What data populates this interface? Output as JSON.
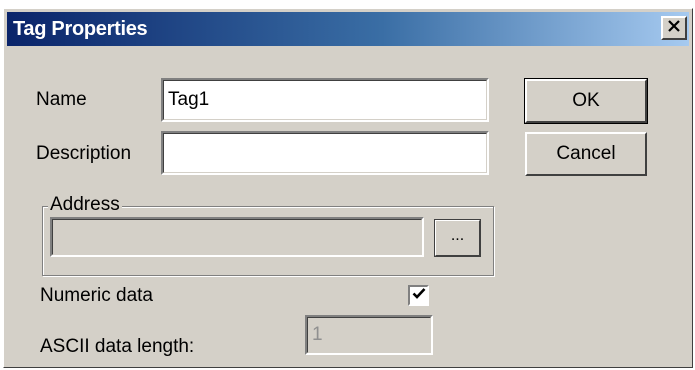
{
  "window": {
    "title": "Tag Properties",
    "close_label": "×"
  },
  "form": {
    "name_label": "Name",
    "name_value": "Tag1",
    "description_label": "Description",
    "description_value": "",
    "address_group_label": "Address",
    "address_value": "",
    "browse_button_label": "...",
    "numeric_label": "Numeric data",
    "numeric_checked": true,
    "ascii_label": "ASCII data length:",
    "ascii_value": "1"
  },
  "buttons": {
    "ok_label": "OK",
    "cancel_label": "Cancel"
  },
  "colors": {
    "title_gradient_start": "#0a246a",
    "title_gradient_end": "#a6caf0",
    "dialog_face": "#d4d0c8"
  }
}
